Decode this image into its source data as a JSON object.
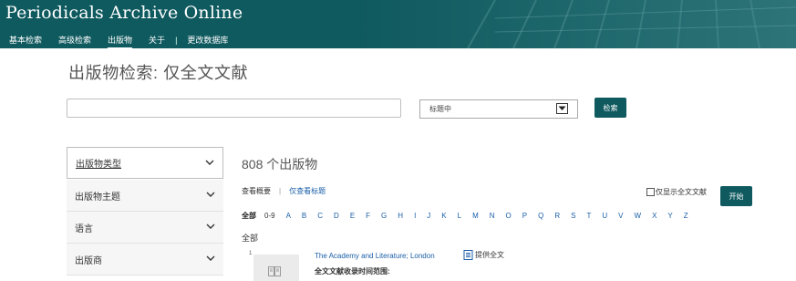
{
  "header": {
    "brand": "Periodicals Archive Online",
    "nav": [
      {
        "label": "基本检索",
        "active": false
      },
      {
        "label": "高级检索",
        "active": false
      },
      {
        "label": "出版物",
        "active": true
      },
      {
        "label": "关于",
        "active": false
      },
      {
        "label": "更改数据库",
        "active": false
      }
    ],
    "nav_separator": "|",
    "background_color": "#0f5a5f"
  },
  "page_title": "出版物检索: 仅全文文献",
  "search": {
    "query_value": "",
    "scope_value": "标题中",
    "scope_arrow_icon": "chevron-down-icon",
    "button_label": "检索"
  },
  "facets": [
    {
      "label": "出版物类型",
      "icon": "chevron-down-icon"
    },
    {
      "label": "出版物主题",
      "icon": "chevron-down-icon"
    },
    {
      "label": "语言",
      "icon": "chevron-down-icon"
    },
    {
      "label": "出版商",
      "icon": "chevron-down-icon"
    }
  ],
  "results": {
    "count_text": "808 个出版物",
    "view_summary": "查看概要",
    "view_separator": "|",
    "view_titles_only": "仅查看标题",
    "fulltext_only_label": "仅显示全文文献",
    "fulltext_only_checked": false,
    "start_button": "开始",
    "alphabet_all": "全部",
    "alphabet": [
      "0-9",
      "A",
      "B",
      "C",
      "D",
      "E",
      "F",
      "G",
      "H",
      "I",
      "J",
      "K",
      "L",
      "M",
      "N",
      "O",
      "P",
      "Q",
      "R",
      "S",
      "T",
      "U",
      "V",
      "W",
      "X",
      "Y",
      "Z"
    ],
    "section_heading": "全部",
    "items": [
      {
        "number": "1",
        "title": "The Academy and Literature; London",
        "badge": "提供全文",
        "coverage_label": "全文文献收录时间范围:"
      }
    ]
  },
  "colors": {
    "accent": "#0f5a5f",
    "link": "#1a5fa8"
  }
}
